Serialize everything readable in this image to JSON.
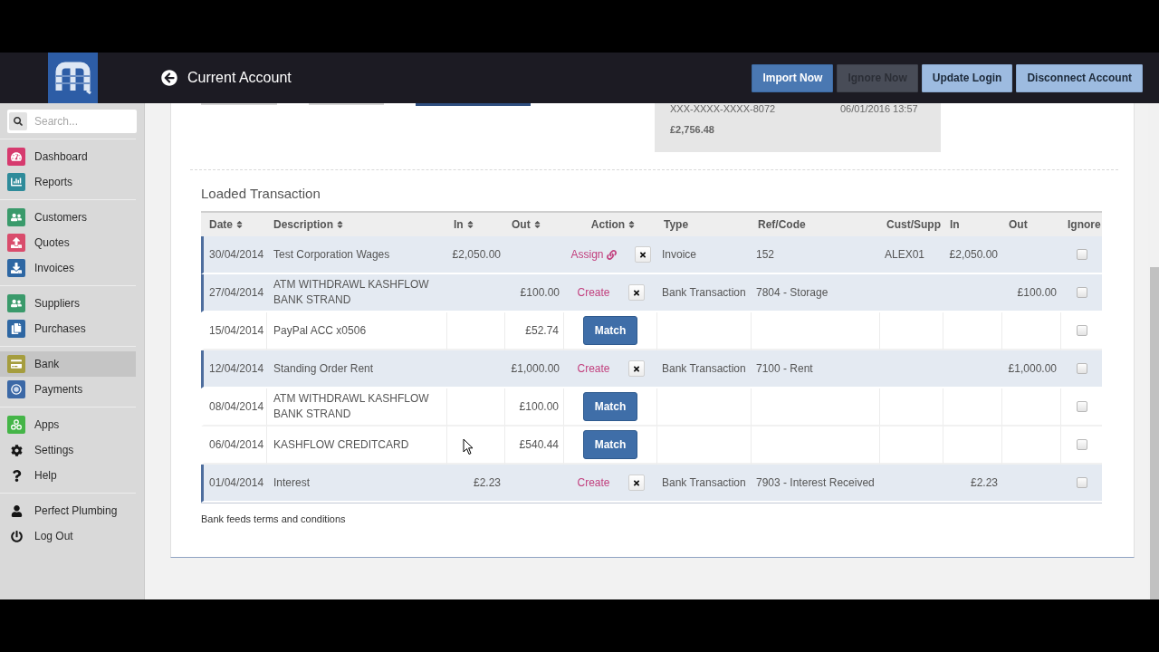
{
  "header": {
    "title": "Current Account",
    "buttons": [
      {
        "label": "Import Now",
        "kind": "primary",
        "disabled": false
      },
      {
        "label": "Ignore Now",
        "kind": "primary",
        "disabled": true
      },
      {
        "label": "Update Login",
        "kind": "light",
        "disabled": false
      },
      {
        "label": "Disconnect Account",
        "kind": "light",
        "disabled": false
      }
    ]
  },
  "sidebar": {
    "search": {
      "placeholder": "Search..."
    },
    "groups": [
      {
        "items": [
          {
            "label": "Dashboard",
            "color": "#d63a6e",
            "selected": false
          },
          {
            "label": "Reports",
            "color": "#2e8b9a",
            "selected": false
          }
        ]
      },
      {
        "items": [
          {
            "label": "Customers",
            "color": "#3a9a6b",
            "selected": false
          },
          {
            "label": "Quotes",
            "color": "#d94c6c",
            "selected": false
          },
          {
            "label": "Invoices",
            "color": "#2e67a3",
            "selected": false
          }
        ]
      },
      {
        "items": [
          {
            "label": "Suppliers",
            "color": "#3a9a6b",
            "selected": false
          },
          {
            "label": "Purchases",
            "color": "#2e67a3",
            "selected": false
          }
        ]
      },
      {
        "items": [
          {
            "label": "Bank",
            "color": "#a59d3e",
            "selected": true
          },
          {
            "label": "Payments",
            "color": "#3b68a6",
            "selected": false
          }
        ]
      },
      {
        "items": [
          {
            "label": "Apps",
            "color": "#45b548",
            "selected": false
          },
          {
            "label": "Settings",
            "selected": false
          },
          {
            "label": "Help",
            "selected": false
          }
        ]
      },
      {
        "items": [
          {
            "label": "Perfect Plumbing",
            "selected": false
          },
          {
            "label": "Log Out",
            "selected": false
          }
        ]
      }
    ]
  },
  "account": {
    "number": "XXX-XXXX-XXXX-8072",
    "updated": "06/01/2016 13:57",
    "balance": "£2,756.48"
  },
  "section_title": "Loaded Transaction",
  "table": {
    "columns": [
      {
        "label": "Date",
        "sortable": true
      },
      {
        "label": "Description",
        "sortable": true
      },
      {
        "label": "In",
        "sortable": true
      },
      {
        "label": "Out",
        "sortable": true
      },
      {
        "label": "Action",
        "sortable": true
      },
      {
        "label": "Type",
        "sortable": false
      },
      {
        "label": "Ref/Code",
        "sortable": false
      },
      {
        "label": "Cust/Supp",
        "sortable": false
      },
      {
        "label": "In",
        "sortable": false
      },
      {
        "label": "Out",
        "sortable": false
      },
      {
        "label": "Ignore",
        "sortable": false
      }
    ],
    "rows": [
      {
        "date": "30/04/2014",
        "description": "Test Corporation Wages",
        "in": "£2,050.00",
        "action": {
          "kind": "assign",
          "label": "Assign",
          "dismiss": true
        },
        "type": "Invoice",
        "ref_code": "152",
        "cust_supp": "ALEX01",
        "matched_in": "£2,050.00",
        "highlighted": true,
        "checked": false
      },
      {
        "date": "27/04/2014",
        "description": "ATM WITHDRAWL KASHFLOW BANK STRAND",
        "out": "£100.00",
        "action": {
          "kind": "create",
          "label": "Create",
          "dismiss": true
        },
        "type": "Bank Transaction",
        "ref_code": "7804 - Storage",
        "matched_out": "£100.00",
        "highlighted": true,
        "checked": false
      },
      {
        "date": "15/04/2014",
        "description": "PayPal ACC x0506",
        "out": "£52.74",
        "action": {
          "kind": "match",
          "label": "Match",
          "dismiss": false
        },
        "highlighted": false,
        "checked": false
      },
      {
        "date": "12/04/2014",
        "description": "Standing Order Rent",
        "out": "£1,000.00",
        "action": {
          "kind": "create",
          "label": "Create",
          "dismiss": true
        },
        "type": "Bank Transaction",
        "ref_code": "7100 - Rent",
        "matched_out": "£1,000.00",
        "highlighted": true,
        "checked": false
      },
      {
        "date": "08/04/2014",
        "description": "ATM WITHDRAWL KASHFLOW BANK STRAND",
        "out": "£100.00",
        "action": {
          "kind": "match",
          "label": "Match",
          "dismiss": false
        },
        "highlighted": false,
        "checked": false
      },
      {
        "date": "06/04/2014",
        "description": "KASHFLOW CREDITCARD",
        "out": "£540.44",
        "action": {
          "kind": "match",
          "label": "Match",
          "dismiss": false
        },
        "highlighted": false,
        "checked": false
      },
      {
        "date": "01/04/2014",
        "description": "Interest",
        "in": "£2.23",
        "action": {
          "kind": "create",
          "label": "Create",
          "dismiss": true
        },
        "type": "Bank Transaction",
        "ref_code": "7903 - Interest Received",
        "matched_in": "£2.23",
        "highlighted": true,
        "checked": false
      }
    ]
  },
  "footer_link": "Bank feeds terms and conditions"
}
